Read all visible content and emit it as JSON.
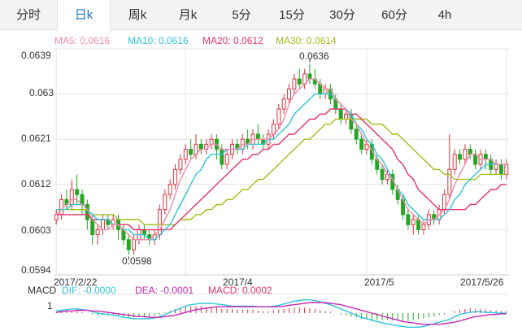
{
  "tabs": [
    {
      "label": "分时",
      "active": false
    },
    {
      "label": "日k",
      "active": true
    },
    {
      "label": "周k",
      "active": false
    },
    {
      "label": "月k",
      "active": false
    },
    {
      "label": "5分",
      "active": false
    },
    {
      "label": "15分",
      "active": false
    },
    {
      "label": "30分",
      "active": false
    },
    {
      "label": "60分",
      "active": false
    },
    {
      "label": "4h",
      "active": false
    }
  ],
  "colors": {
    "up": "#d9343d",
    "down": "#26a526",
    "ma5": "#f08caa",
    "ma10": "#2ec4dc",
    "ma20": "#e8336a",
    "ma30": "#9fbf1a",
    "dif": "#2ec4dc",
    "dea": "#c728b8",
    "macd_text": "#e8336a",
    "grid": "#e6e6e6",
    "active_tab": "#1f6fc9"
  },
  "ma_legend": [
    {
      "label": "MA5: 0.0616",
      "color_key": "ma5"
    },
    {
      "label": "MA10: 0.0616",
      "color_key": "ma10"
    },
    {
      "label": "MA20: 0.0612",
      "color_key": "ma20"
    },
    {
      "label": "MA30: 0.0614",
      "color_key": "ma30"
    }
  ],
  "macd_legend": {
    "title": "MACD",
    "dif": "DIF: -0.0000",
    "dea": "DEA: -0.0001",
    "macd": "MACD: 0.0002"
  },
  "macd_axis_label": "1",
  "annotations": {
    "high": "0.0636",
    "low": "0.0598"
  },
  "chart_data": {
    "type": "candlestick",
    "title": "",
    "y_ticks": [
      "0.0639",
      "0.063",
      "0.0621",
      "0.0612",
      "0.0603",
      "0.0594"
    ],
    "ylim": [
      0.0594,
      0.0639
    ],
    "x_labels": [
      "2017/2/22",
      "2017/4",
      "2017/5",
      "2017/5/26"
    ],
    "x_label_positions": [
      0,
      25,
      60,
      87
    ],
    "candle_count": 88,
    "high_index": 49,
    "low_index": 14,
    "candles_ohlc": [
      [
        0.0605,
        0.0606,
        0.0607,
        0.0604
      ],
      [
        0.0606,
        0.0609,
        0.061,
        0.0605
      ],
      [
        0.0609,
        0.0608,
        0.0611,
        0.0607
      ],
      [
        0.0608,
        0.0611,
        0.0613,
        0.0607
      ],
      [
        0.0611,
        0.061,
        0.0614,
        0.0608
      ],
      [
        0.061,
        0.0608,
        0.0611,
        0.0606
      ],
      [
        0.0608,
        0.0605,
        0.0609,
        0.0603
      ],
      [
        0.0605,
        0.0602,
        0.0606,
        0.06
      ],
      [
        0.0602,
        0.0603,
        0.0604,
        0.06
      ],
      [
        0.0603,
        0.0605,
        0.0606,
        0.0602
      ],
      [
        0.0605,
        0.0604,
        0.0606,
        0.0603
      ],
      [
        0.0604,
        0.0605,
        0.0606,
        0.0603
      ],
      [
        0.0605,
        0.0603,
        0.0606,
        0.0601
      ],
      [
        0.0603,
        0.0601,
        0.0604,
        0.06
      ],
      [
        0.0601,
        0.0599,
        0.0602,
        0.0598
      ],
      [
        0.0599,
        0.0601,
        0.0602,
        0.0598
      ],
      [
        0.0601,
        0.0603,
        0.0604,
        0.06
      ],
      [
        0.0603,
        0.0602,
        0.0604,
        0.0601
      ],
      [
        0.0602,
        0.0601,
        0.0603,
        0.06
      ],
      [
        0.0601,
        0.0602,
        0.0603,
        0.06
      ],
      [
        0.0602,
        0.0607,
        0.0608,
        0.0601
      ],
      [
        0.0607,
        0.061,
        0.0611,
        0.0606
      ],
      [
        0.061,
        0.0612,
        0.0613,
        0.0609
      ],
      [
        0.0612,
        0.0615,
        0.0616,
        0.0611
      ],
      [
        0.0615,
        0.0617,
        0.0618,
        0.0614
      ],
      [
        0.0617,
        0.0619,
        0.062,
        0.0616
      ],
      [
        0.0619,
        0.0618,
        0.0621,
        0.0617
      ],
      [
        0.0618,
        0.062,
        0.0622,
        0.0617
      ],
      [
        0.062,
        0.0619,
        0.0621,
        0.0618
      ],
      [
        0.0619,
        0.062,
        0.0621,
        0.0618
      ],
      [
        0.062,
        0.0621,
        0.0622,
        0.0619
      ],
      [
        0.0621,
        0.0619,
        0.0622,
        0.0617
      ],
      [
        0.0619,
        0.0616,
        0.062,
        0.0615
      ],
      [
        0.0616,
        0.0618,
        0.0619,
        0.0615
      ],
      [
        0.0618,
        0.062,
        0.0621,
        0.0617
      ],
      [
        0.062,
        0.0619,
        0.0621,
        0.0618
      ],
      [
        0.0619,
        0.0621,
        0.0622,
        0.0618
      ],
      [
        0.0621,
        0.062,
        0.0623,
        0.0619
      ],
      [
        0.062,
        0.0622,
        0.0623,
        0.0619
      ],
      [
        0.0622,
        0.0621,
        0.0624,
        0.062
      ],
      [
        0.0621,
        0.062,
        0.0622,
        0.0619
      ],
      [
        0.062,
        0.0622,
        0.0623,
        0.0619
      ],
      [
        0.0622,
        0.0624,
        0.0625,
        0.0621
      ],
      [
        0.0624,
        0.0627,
        0.0628,
        0.0623
      ],
      [
        0.0627,
        0.0629,
        0.063,
        0.0626
      ],
      [
        0.0629,
        0.0631,
        0.0632,
        0.0628
      ],
      [
        0.0631,
        0.0633,
        0.0634,
        0.063
      ],
      [
        0.0633,
        0.0632,
        0.0635,
        0.0631
      ],
      [
        0.0632,
        0.0634,
        0.0635,
        0.0631
      ],
      [
        0.0634,
        0.0633,
        0.0636,
        0.0632
      ],
      [
        0.0633,
        0.0632,
        0.0635,
        0.0631
      ],
      [
        0.0632,
        0.063,
        0.0633,
        0.0629
      ],
      [
        0.063,
        0.0631,
        0.0632,
        0.0629
      ],
      [
        0.0631,
        0.0629,
        0.0632,
        0.0628
      ],
      [
        0.0629,
        0.0627,
        0.063,
        0.0626
      ],
      [
        0.0627,
        0.0625,
        0.0628,
        0.0624
      ],
      [
        0.0625,
        0.0626,
        0.0627,
        0.0624
      ],
      [
        0.0626,
        0.0623,
        0.0627,
        0.0622
      ],
      [
        0.0623,
        0.0621,
        0.0624,
        0.062
      ],
      [
        0.0621,
        0.0619,
        0.0622,
        0.0618
      ],
      [
        0.0619,
        0.062,
        0.0621,
        0.0618
      ],
      [
        0.062,
        0.0617,
        0.0621,
        0.0616
      ],
      [
        0.0617,
        0.0615,
        0.0618,
        0.0614
      ],
      [
        0.0615,
        0.0613,
        0.0616,
        0.0612
      ],
      [
        0.0613,
        0.0614,
        0.0615,
        0.0612
      ],
      [
        0.0614,
        0.0611,
        0.0615,
        0.061
      ],
      [
        0.0611,
        0.0609,
        0.0612,
        0.0608
      ],
      [
        0.0609,
        0.0606,
        0.061,
        0.0605
      ],
      [
        0.0606,
        0.0604,
        0.0607,
        0.0603
      ],
      [
        0.0604,
        0.0605,
        0.0606,
        0.0602
      ],
      [
        0.0605,
        0.0603,
        0.0606,
        0.0602
      ],
      [
        0.0603,
        0.0604,
        0.0605,
        0.0602
      ],
      [
        0.0604,
        0.0606,
        0.0607,
        0.0603
      ],
      [
        0.0606,
        0.0605,
        0.0607,
        0.0604
      ],
      [
        0.0605,
        0.0607,
        0.0608,
        0.0604
      ],
      [
        0.0607,
        0.061,
        0.0611,
        0.0606
      ],
      [
        0.061,
        0.0615,
        0.0622,
        0.0609
      ],
      [
        0.0615,
        0.0618,
        0.0619,
        0.0614
      ],
      [
        0.0618,
        0.0617,
        0.0619,
        0.0616
      ],
      [
        0.0617,
        0.0619,
        0.062,
        0.0616
      ],
      [
        0.0619,
        0.0618,
        0.062,
        0.0617
      ],
      [
        0.0618,
        0.0616,
        0.0619,
        0.0615
      ],
      [
        0.0616,
        0.0618,
        0.0619,
        0.0615
      ],
      [
        0.0618,
        0.0617,
        0.0619,
        0.0615
      ],
      [
        0.0617,
        0.0615,
        0.0618,
        0.0614
      ],
      [
        0.0615,
        0.0616,
        0.0617,
        0.0614
      ],
      [
        0.0616,
        0.0614,
        0.0617,
        0.0613
      ],
      [
        0.0614,
        0.0616,
        0.0617,
        0.0613
      ]
    ],
    "ma5": [
      0.0606,
      0.0607,
      0.0608,
      0.0609,
      0.0609,
      0.0608,
      0.0607,
      0.0605,
      0.0604,
      0.0603,
      0.0603,
      0.0604,
      0.0604,
      0.0603,
      0.0602,
      0.0601,
      0.0601,
      0.0601,
      0.0601,
      0.0602,
      0.0603,
      0.0605,
      0.0607,
      0.061,
      0.0613,
      0.0615,
      0.0617,
      0.0618,
      0.0619,
      0.0619,
      0.062,
      0.062,
      0.0619,
      0.0619,
      0.0619,
      0.0619,
      0.062,
      0.062,
      0.0621,
      0.0621,
      0.0621,
      0.0621,
      0.0622,
      0.0623,
      0.0625,
      0.0628,
      0.063,
      0.0631,
      0.0632,
      0.0633,
      0.0633,
      0.0632,
      0.0631,
      0.0631,
      0.0629,
      0.0628,
      0.0627,
      0.0625,
      0.0624,
      0.0622,
      0.062,
      0.0619,
      0.0617,
      0.0616,
      0.0614,
      0.0613,
      0.0611,
      0.0609,
      0.0607,
      0.0606,
      0.0605,
      0.0604,
      0.0605,
      0.0605,
      0.0606,
      0.0607,
      0.0609,
      0.0612,
      0.0614,
      0.0616,
      0.0618,
      0.0618,
      0.0617,
      0.0617,
      0.0617,
      0.0616,
      0.0616,
      0.0616
    ],
    "ma10": [
      0.0607,
      0.0607,
      0.0607,
      0.0608,
      0.0608,
      0.0608,
      0.0607,
      0.0606,
      0.0605,
      0.0605,
      0.0605,
      0.0604,
      0.0604,
      0.0603,
      0.0603,
      0.0602,
      0.0602,
      0.0602,
      0.0601,
      0.0601,
      0.0602,
      0.0603,
      0.0604,
      0.0606,
      0.0608,
      0.061,
      0.0612,
      0.0614,
      0.0615,
      0.0617,
      0.0618,
      0.0618,
      0.0618,
      0.0619,
      0.0619,
      0.0619,
      0.0619,
      0.062,
      0.062,
      0.062,
      0.062,
      0.0621,
      0.0621,
      0.0622,
      0.0623,
      0.0624,
      0.0626,
      0.0627,
      0.0628,
      0.0629,
      0.063,
      0.063,
      0.063,
      0.063,
      0.0629,
      0.0628,
      0.0627,
      0.0626,
      0.0624,
      0.0623,
      0.0621,
      0.062,
      0.0618,
      0.0617,
      0.0615,
      0.0613,
      0.0611,
      0.061,
      0.0608,
      0.0607,
      0.0606,
      0.0605,
      0.0605,
      0.0605,
      0.0605,
      0.0606,
      0.0607,
      0.0609,
      0.061,
      0.0612,
      0.0613,
      0.0614,
      0.0615,
      0.0616,
      0.0616,
      0.0616,
      0.0616,
      0.0616
    ],
    "ma20": [
      0.0606,
      0.0606,
      0.0606,
      0.0606,
      0.0606,
      0.0606,
      0.0606,
      0.0605,
      0.0605,
      0.0605,
      0.0605,
      0.0604,
      0.0604,
      0.0604,
      0.0604,
      0.0603,
      0.0603,
      0.0603,
      0.0603,
      0.0603,
      0.0603,
      0.0603,
      0.0603,
      0.0604,
      0.0605,
      0.0606,
      0.0607,
      0.0608,
      0.0609,
      0.061,
      0.0611,
      0.0612,
      0.0613,
      0.0614,
      0.0615,
      0.0616,
      0.0617,
      0.0617,
      0.0618,
      0.0618,
      0.0619,
      0.0619,
      0.062,
      0.062,
      0.0621,
      0.0622,
      0.0622,
      0.0623,
      0.0624,
      0.0625,
      0.0625,
      0.0626,
      0.0626,
      0.0627,
      0.0627,
      0.0627,
      0.0627,
      0.0626,
      0.0626,
      0.0625,
      0.0624,
      0.0623,
      0.0622,
      0.0621,
      0.062,
      0.0619,
      0.0617,
      0.0616,
      0.0614,
      0.0613,
      0.0611,
      0.061,
      0.0609,
      0.0608,
      0.0607,
      0.0607,
      0.0607,
      0.0607,
      0.0607,
      0.0607,
      0.0608,
      0.0608,
      0.0609,
      0.061,
      0.0611,
      0.0611,
      0.0612,
      0.0612
    ],
    "ma30": [
      0.0607,
      0.0607,
      0.0607,
      0.0607,
      0.0607,
      0.0607,
      0.0607,
      0.0606,
      0.0606,
      0.0606,
      0.0606,
      0.0606,
      0.0605,
      0.0605,
      0.0605,
      0.0605,
      0.0605,
      0.0604,
      0.0604,
      0.0604,
      0.0604,
      0.0604,
      0.0604,
      0.0604,
      0.0605,
      0.0605,
      0.0605,
      0.0606,
      0.0606,
      0.0607,
      0.0607,
      0.0608,
      0.0608,
      0.0609,
      0.0609,
      0.061,
      0.0611,
      0.0611,
      0.0612,
      0.0613,
      0.0613,
      0.0614,
      0.0615,
      0.0616,
      0.0617,
      0.0618,
      0.0619,
      0.062,
      0.0621,
      0.0621,
      0.0622,
      0.0623,
      0.0624,
      0.0624,
      0.0625,
      0.0625,
      0.0625,
      0.0625,
      0.0625,
      0.0625,
      0.0625,
      0.0624,
      0.0624,
      0.0624,
      0.0623,
      0.0622,
      0.0622,
      0.0621,
      0.062,
      0.0619,
      0.0618,
      0.0617,
      0.0616,
      0.0615,
      0.0615,
      0.0614,
      0.0614,
      0.0613,
      0.0613,
      0.0613,
      0.0613,
      0.0613,
      0.0614,
      0.0614,
      0.0614,
      0.0614,
      0.0614,
      0.0614
    ],
    "macd_hist": [
      0.2,
      0.3,
      0.4,
      0.4,
      0.3,
      0.2,
      0.0,
      -0.2,
      -0.3,
      -0.3,
      -0.3,
      -0.3,
      -0.4,
      -0.5,
      -0.6,
      -0.6,
      -0.5,
      -0.5,
      -0.5,
      -0.4,
      -0.2,
      0.1,
      0.3,
      0.6,
      0.8,
      0.9,
      1.0,
      1.0,
      1.0,
      0.9,
      0.9,
      0.8,
      0.6,
      0.6,
      0.6,
      0.5,
      0.5,
      0.5,
      0.5,
      0.4,
      0.3,
      0.3,
      0.4,
      0.5,
      0.6,
      0.7,
      0.8,
      0.8,
      0.8,
      0.7,
      0.6,
      0.4,
      0.3,
      0.2,
      0.0,
      -0.2,
      -0.3,
      -0.5,
      -0.6,
      -0.8,
      -0.8,
      -0.9,
      -1.0,
      -1.0,
      -1.0,
      -1.1,
      -1.1,
      -1.1,
      -1.1,
      -1.0,
      -0.9,
      -0.8,
      -0.6,
      -0.5,
      -0.3,
      -0.2,
      0.0,
      0.3,
      0.5,
      0.6,
      0.7,
      0.6,
      0.6,
      0.5,
      0.4,
      0.4,
      0.3,
      0.3
    ],
    "dif": [
      0.3,
      0.4,
      0.5,
      0.6,
      0.6,
      0.5,
      0.4,
      0.2,
      0.0,
      -0.1,
      -0.2,
      -0.3,
      -0.4,
      -0.6,
      -0.7,
      -0.8,
      -0.8,
      -0.8,
      -0.8,
      -0.7,
      -0.5,
      -0.2,
      0.1,
      0.4,
      0.7,
      1.0,
      1.2,
      1.3,
      1.4,
      1.4,
      1.4,
      1.3,
      1.2,
      1.1,
      1.0,
      1.0,
      1.0,
      1.0,
      1.0,
      0.9,
      0.9,
      0.9,
      1.0,
      1.1,
      1.3,
      1.5,
      1.7,
      1.8,
      1.9,
      1.9,
      1.8,
      1.6,
      1.4,
      1.2,
      0.9,
      0.6,
      0.3,
      0.0,
      -0.3,
      -0.6,
      -0.8,
      -1.0,
      -1.2,
      -1.4,
      -1.5,
      -1.7,
      -1.8,
      -1.9,
      -2.0,
      -2.0,
      -2.0,
      -1.9,
      -1.7,
      -1.5,
      -1.3,
      -1.1,
      -0.9,
      -0.5,
      -0.2,
      0.0,
      0.1,
      0.2,
      0.2,
      0.1,
      0.1,
      0.0,
      0.0,
      0.0
    ],
    "dea": [
      0.1,
      0.2,
      0.3,
      0.3,
      0.4,
      0.4,
      0.4,
      0.3,
      0.3,
      0.2,
      0.1,
      0.0,
      -0.1,
      -0.2,
      -0.3,
      -0.4,
      -0.5,
      -0.5,
      -0.6,
      -0.6,
      -0.6,
      -0.5,
      -0.4,
      -0.3,
      -0.1,
      0.1,
      0.3,
      0.5,
      0.6,
      0.7,
      0.8,
      0.9,
      0.9,
      0.9,
      0.9,
      0.9,
      0.9,
      0.9,
      0.9,
      0.9,
      0.9,
      0.9,
      0.9,
      0.9,
      1.0,
      1.1,
      1.2,
      1.3,
      1.4,
      1.5,
      1.5,
      1.5,
      1.5,
      1.4,
      1.3,
      1.2,
      1.0,
      0.8,
      0.6,
      0.4,
      0.2,
      0.0,
      -0.2,
      -0.4,
      -0.6,
      -0.8,
      -1.0,
      -1.2,
      -1.3,
      -1.4,
      -1.5,
      -1.6,
      -1.6,
      -1.6,
      -1.6,
      -1.5,
      -1.4,
      -1.3,
      -1.1,
      -0.9,
      -0.7,
      -0.5,
      -0.4,
      -0.3,
      -0.2,
      -0.2,
      -0.1,
      -0.1
    ],
    "macd_ylim": [
      -2.2,
      2.2
    ]
  }
}
